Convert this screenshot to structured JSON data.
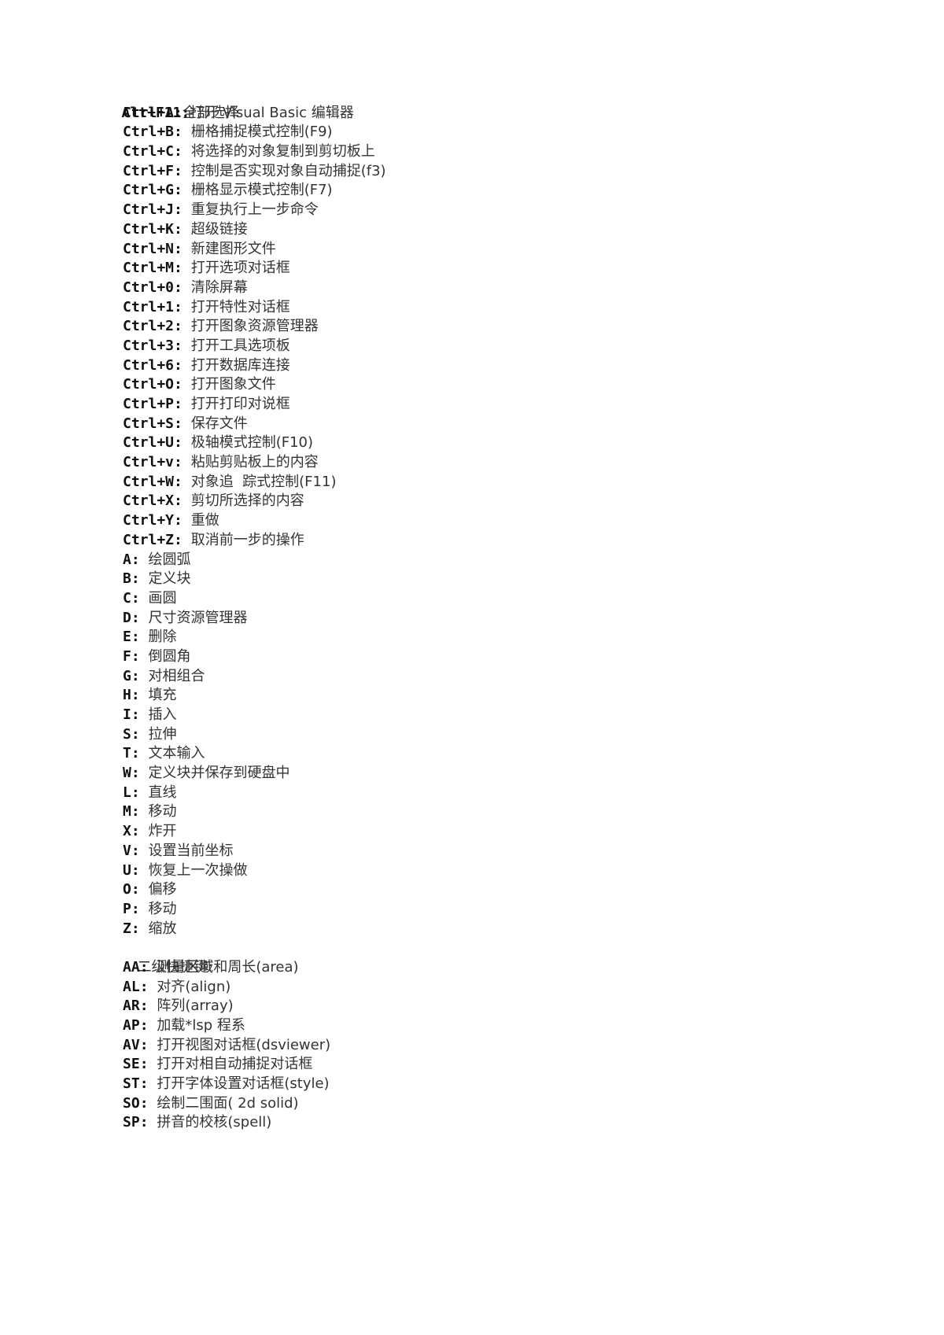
{
  "document": {
    "header": {
      "key": "Alt+F11",
      "sep": ":",
      "desc": "打开 Visual Basic 编辑器"
    },
    "ctrl_shortcuts": [
      {
        "key": "Ctrl+A",
        "sep": ":",
        "desc": "全部选择"
      },
      {
        "key": "Ctrl+B",
        "sep": ": ",
        "desc": "栅格捕捉模式控制(F9)"
      },
      {
        "key": "Ctrl+C",
        "sep": ": ",
        "desc": "将选择的对象复制到剪切板上"
      },
      {
        "key": "Ctrl+F",
        "sep": ": ",
        "desc": "控制是否实现对象自动捕捉(f3)"
      },
      {
        "key": "Ctrl+G",
        "sep": ": ",
        "desc": "栅格显示模式控制(F7)"
      },
      {
        "key": "Ctrl+J",
        "sep": ": ",
        "desc": "重复执行上一步命令"
      },
      {
        "key": "Ctrl+K",
        "sep": ": ",
        "desc": "超级链接"
      },
      {
        "key": "Ctrl+N",
        "sep": ": ",
        "desc": "新建图形文件"
      },
      {
        "key": "Ctrl+M",
        "sep": ": ",
        "desc": "打开选项对话框"
      },
      {
        "key": "Ctrl+0",
        "sep": ": ",
        "desc": "清除屏幕"
      },
      {
        "key": "Ctrl+1",
        "sep": ": ",
        "desc": "打开特性对话框"
      },
      {
        "key": "Ctrl+2",
        "sep": ": ",
        "desc": "打开图象资源管理器"
      },
      {
        "key": "Ctrl+3",
        "sep": ": ",
        "desc": "打开工具选项板"
      },
      {
        "key": "Ctrl+6",
        "sep": ": ",
        "desc": "打开数据库连接"
      },
      {
        "key": "Ctrl+O",
        "sep": ": ",
        "desc": "打开图象文件"
      },
      {
        "key": "Ctrl+P",
        "sep": ": ",
        "desc": "打开打印对说框"
      },
      {
        "key": "Ctrl+S",
        "sep": ": ",
        "desc": "保存文件"
      },
      {
        "key": "Ctrl+U",
        "sep": ": ",
        "desc": "极轴模式控制(F10)"
      },
      {
        "key": "Ctrl+v",
        "sep": ": ",
        "desc": "粘贴剪贴板上的内容"
      },
      {
        "key": "Ctrl+W",
        "sep": ": ",
        "desc": "对象追  踪式控制(F11)"
      },
      {
        "key": "Ctrl+X",
        "sep": ": ",
        "desc": "剪切所选择的内容"
      },
      {
        "key": "Ctrl+Y",
        "sep": ": ",
        "desc": "重做"
      },
      {
        "key": "Ctrl+Z",
        "sep": ": ",
        "desc": "取消前一步的操作"
      }
    ],
    "single_shortcuts": [
      {
        "key": "A",
        "sep": ": ",
        "desc": "绘圆弧"
      },
      {
        "key": "B",
        "sep": ": ",
        "desc": "定义块"
      },
      {
        "key": "C",
        "sep": ": ",
        "desc": "画圆"
      },
      {
        "key": "D",
        "sep": ": ",
        "desc": "尺寸资源管理器"
      },
      {
        "key": "E",
        "sep": ": ",
        "desc": "删除"
      },
      {
        "key": "F",
        "sep": ": ",
        "desc": "倒圆角"
      },
      {
        "key": "G",
        "sep": ": ",
        "desc": "对相组合"
      },
      {
        "key": "H",
        "sep": ": ",
        "desc": "填充"
      },
      {
        "key": "I",
        "sep": ": ",
        "desc": "插入"
      },
      {
        "key": "S",
        "sep": ": ",
        "desc": "拉伸"
      },
      {
        "key": "T",
        "sep": ": ",
        "desc": "文本输入"
      },
      {
        "key": "W",
        "sep": ": ",
        "desc": "定义块并保存到硬盘中"
      },
      {
        "key": "L",
        "sep": ": ",
        "desc": "直线"
      },
      {
        "key": "M",
        "sep": ": ",
        "desc": "移动"
      },
      {
        "key": "X",
        "sep": ": ",
        "desc": "炸开"
      },
      {
        "key": "V",
        "sep": ": ",
        "desc": "设置当前坐标"
      },
      {
        "key": "U",
        "sep": ": ",
        "desc": "恢复上一次操做"
      },
      {
        "key": "O",
        "sep": ": ",
        "desc": "偏移"
      },
      {
        "key": "P",
        "sep": ": ",
        "desc": "移动"
      },
      {
        "key": "Z",
        "sep": ": ",
        "desc": "缩放"
      }
    ],
    "secondary_heading": "二级快捷键:",
    "secondary_shortcuts": [
      {
        "key": "AA",
        "sep": ": ",
        "desc": "测量区域和周长(area)"
      },
      {
        "key": "AL",
        "sep": ": ",
        "desc": "对齐(align)"
      },
      {
        "key": "AR",
        "sep": ": ",
        "desc": "阵列(array)"
      },
      {
        "key": "AP",
        "sep": ": ",
        "desc": "加载*lsp 程系"
      },
      {
        "key": "AV",
        "sep": ": ",
        "desc": "打开视图对话框(dsviewer)"
      },
      {
        "key": "SE",
        "sep": ": ",
        "desc": "打开对相自动捕捉对话框"
      },
      {
        "key": "ST",
        "sep": ": ",
        "desc": "打开字体设置对话框(style)"
      },
      {
        "key": "SO",
        "sep": ": ",
        "desc": "绘制二围面( 2d solid)"
      },
      {
        "key": "SP",
        "sep": ": ",
        "desc": "拼音的校核(spell)"
      }
    ]
  }
}
